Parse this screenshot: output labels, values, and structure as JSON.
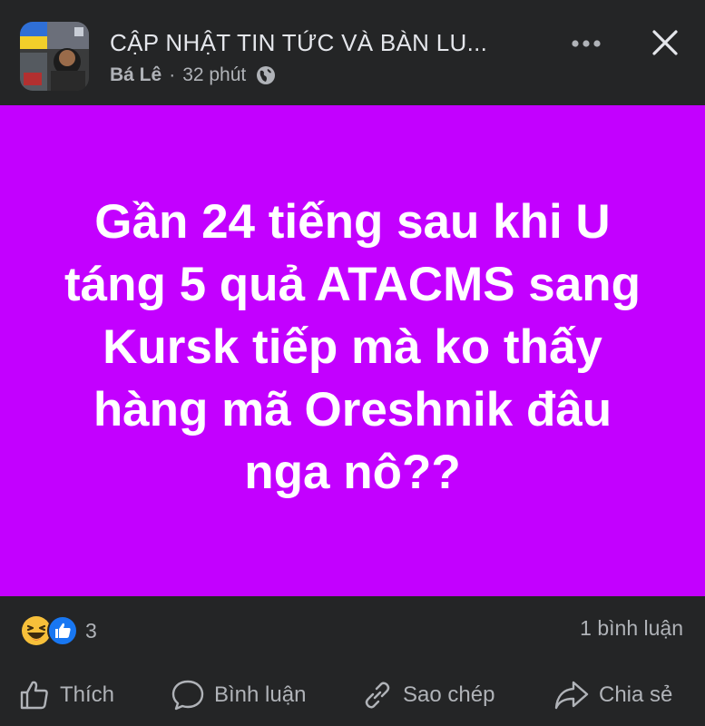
{
  "header": {
    "group_name": "CẬP NHẬT TIN TỨC VÀ BÀN LU...",
    "author": "Bá Lê",
    "separator": "·",
    "time": "32 phút",
    "privacy_icon": "globe-icon",
    "more_icon": "more-dots-icon",
    "close_icon": "close-icon"
  },
  "post": {
    "background_color": "#c300ff",
    "text": "Gần 24 tiếng sau khi U táng 5 quả ATACMS sang Kursk tiếp mà ko thấy hàng mã Oreshnik đâu nga nô??"
  },
  "stats": {
    "reaction_icons": [
      "haha-emoji-icon",
      "like-reaction-icon"
    ],
    "reaction_count": "3",
    "comment_count": "1 bình luận"
  },
  "actions": {
    "like": "Thích",
    "comment": "Bình luận",
    "copy": "Sao chép",
    "share": "Chia sẻ"
  }
}
